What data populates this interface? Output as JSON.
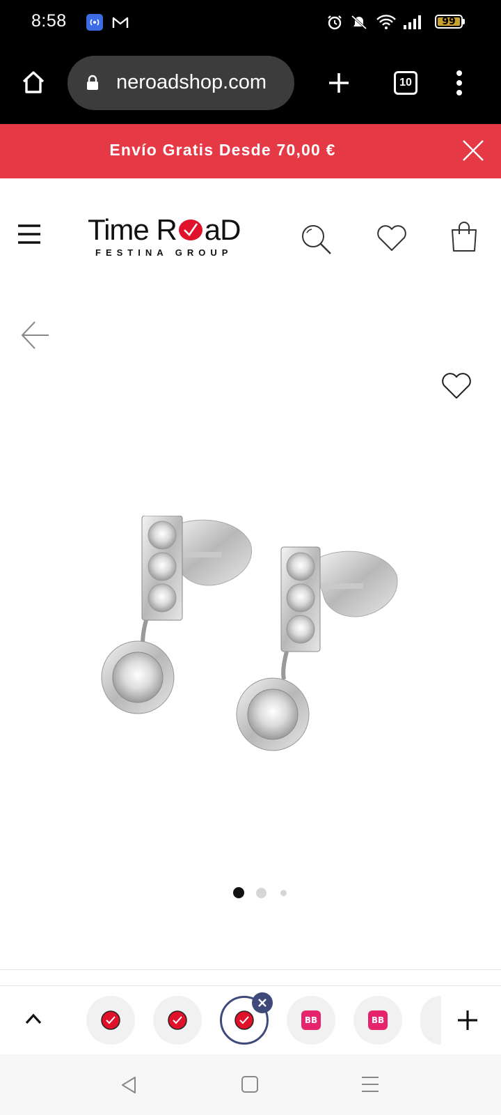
{
  "status_bar": {
    "time": "8:58",
    "battery": "99",
    "icons": [
      "hotspot-icon",
      "gmail-icon",
      "alarm-icon",
      "mute-icon",
      "wifi-icon",
      "signal-icon",
      "battery-icon"
    ]
  },
  "browser": {
    "url": "neroadshop.com",
    "tab_count": "10"
  },
  "promo": {
    "text": "Envío Gratis Desde 70,00 €"
  },
  "header": {
    "logo_title_left": "Time R",
    "logo_title_right": "aD",
    "logo_subtitle": "FESTINA GROUP"
  },
  "product": {
    "image_name": "earrings-product-image",
    "carousel": {
      "slides": 3,
      "active": 0
    }
  },
  "tab_strip": {
    "tabs": [
      {
        "icon": "timeroad-icon"
      },
      {
        "icon": "timeroad-icon"
      },
      {
        "icon": "timeroad-icon",
        "active": true
      },
      {
        "icon": "bb-icon",
        "label": "BB"
      },
      {
        "icon": "bb-icon",
        "label": "BB"
      }
    ]
  },
  "colors": {
    "promo": "#e63946",
    "brand_red": "#e0112b",
    "tab_accent": "#3f4a7a"
  }
}
